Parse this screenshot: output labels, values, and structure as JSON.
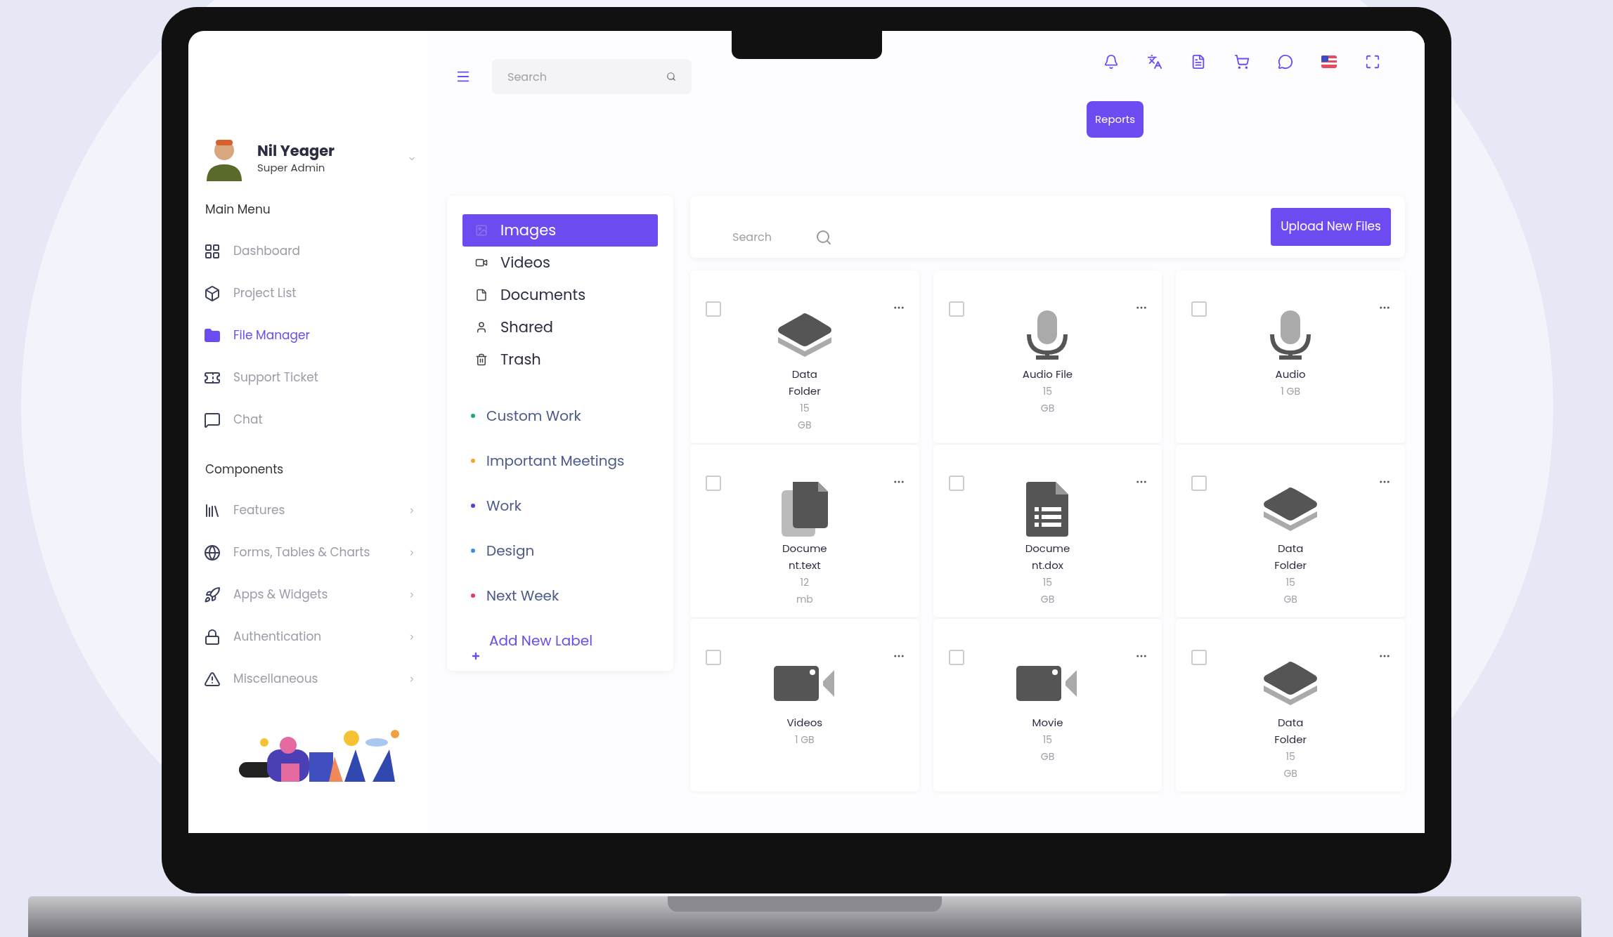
{
  "profile": {
    "name": "Nil Yeager",
    "role": "Super Admin"
  },
  "sidebar": {
    "sections": [
      {
        "heading": "Main Menu",
        "items": [
          {
            "label": "Dashboard",
            "selected": false,
            "expandable": false
          },
          {
            "label": "Project List",
            "selected": false,
            "expandable": false
          },
          {
            "label": "File Manager",
            "selected": true,
            "expandable": false
          },
          {
            "label": "Support Ticket",
            "selected": false,
            "expandable": false
          },
          {
            "label": "Chat",
            "selected": false,
            "expandable": false
          }
        ]
      },
      {
        "heading": "Components",
        "items": [
          {
            "label": "Features",
            "selected": false,
            "expandable": true
          },
          {
            "label": "Forms, Tables & Charts",
            "selected": false,
            "expandable": true
          },
          {
            "label": "Apps & Widgets",
            "selected": false,
            "expandable": true
          },
          {
            "label": "Authentication",
            "selected": false,
            "expandable": true
          },
          {
            "label": "Miscellaneous",
            "selected": false,
            "expandable": true
          }
        ]
      }
    ]
  },
  "topbar": {
    "search": {
      "placeholder": "Search"
    },
    "reports_button": "Reports"
  },
  "file_nav": [
    {
      "label": "Images",
      "selected": true
    },
    {
      "label": "Videos",
      "selected": false
    },
    {
      "label": "Documents",
      "selected": false
    },
    {
      "label": "Shared",
      "selected": false
    },
    {
      "label": "Trash",
      "selected": false
    }
  ],
  "labels": [
    {
      "label": "Custom Work",
      "color": "#1fa67a"
    },
    {
      "label": "Important Meetings",
      "color": "#f5a623"
    },
    {
      "label": "Work",
      "color": "#5b3fd6"
    },
    {
      "label": "Design",
      "color": "#3b8de8"
    },
    {
      "label": "Next Week",
      "color": "#e83b5a"
    }
  ],
  "add_label": "Add New Label",
  "files_toolbar": {
    "search": {
      "placeholder": "Search"
    },
    "upload_button": "Upload New Files"
  },
  "files": [
    {
      "kind": "stack",
      "name": "Data Folder",
      "size": "15 GB",
      "checked": false
    },
    {
      "kind": "audio",
      "name": "Audio File",
      "size": "15 GB",
      "checked": false
    },
    {
      "kind": "audio",
      "name": "Audio",
      "size": "1 GB",
      "checked": false
    },
    {
      "kind": "copies",
      "name": "Document.text",
      "size": "12 mb",
      "checked": false
    },
    {
      "kind": "sheet",
      "name": "Document.dox",
      "size": "15 GB",
      "checked": false
    },
    {
      "kind": "stack",
      "name": "Data Folder",
      "size": "15 GB",
      "checked": false
    },
    {
      "kind": "video",
      "name": "Videos",
      "size": "1 GB",
      "checked": false
    },
    {
      "kind": "video",
      "name": "Movie",
      "size": "15 GB",
      "checked": false
    },
    {
      "kind": "stack",
      "name": "Data Folder",
      "size": "15 GB",
      "checked": false
    }
  ]
}
